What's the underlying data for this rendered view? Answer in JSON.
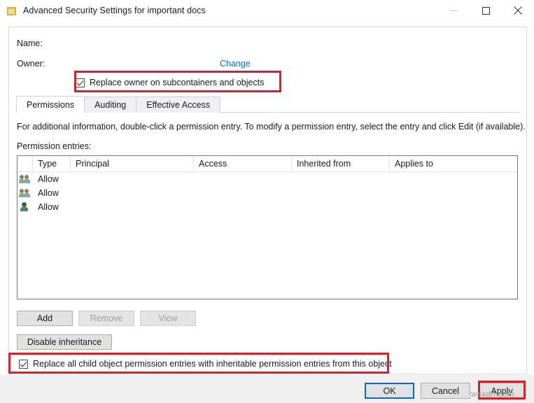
{
  "window": {
    "title": "Advanced Security Settings for important docs",
    "icon": "folder-icon",
    "minimize_label": "–",
    "maximize_label": "□",
    "close_label": "✕"
  },
  "header": {
    "name_label": "Name:",
    "name_value": "",
    "owner_label": "Owner:",
    "owner_value": "",
    "change_link": "Change",
    "replace_owner_checkbox": {
      "label": "Replace owner on subcontainers and objects",
      "checked": true
    }
  },
  "tabs": [
    {
      "label": "Permissions",
      "active": true
    },
    {
      "label": "Auditing",
      "active": false
    },
    {
      "label": "Effective Access",
      "active": false
    }
  ],
  "main": {
    "info_text": "For additional information, double-click a permission entry. To modify a permission entry, select the entry and click Edit (if available).",
    "entries_label": "Permission entries:",
    "columns": [
      "",
      "Type",
      "Principal",
      "Access",
      "Inherited from",
      "Applies to"
    ],
    "rows": [
      {
        "icon": "group-icon",
        "type": "Allow",
        "principal": "",
        "access": "",
        "inherited_from": "",
        "applies_to": ""
      },
      {
        "icon": "group-icon",
        "type": "Allow",
        "principal": "",
        "access": "",
        "inherited_from": "",
        "applies_to": ""
      },
      {
        "icon": "user-icon",
        "type": "Allow",
        "principal": "",
        "access": "",
        "inherited_from": "",
        "applies_to": ""
      }
    ],
    "buttons": {
      "add": "Add",
      "remove": "Remove",
      "view": "View",
      "disable_inheritance": "Disable inheritance"
    },
    "replace_children_checkbox": {
      "label": "Replace all child object permission entries with inheritable permission entries from this object",
      "checked": true
    }
  },
  "footer": {
    "ok": "OK",
    "cancel": "Cancel",
    "apply": "Apply"
  },
  "watermark": "wsxdn.com",
  "colors": {
    "link": "#0a6cc4",
    "annotation": "#d1222b",
    "focus_border": "#0a68c7",
    "button_face": "#e1e1e1",
    "footer_bg": "#f0f0f0"
  }
}
